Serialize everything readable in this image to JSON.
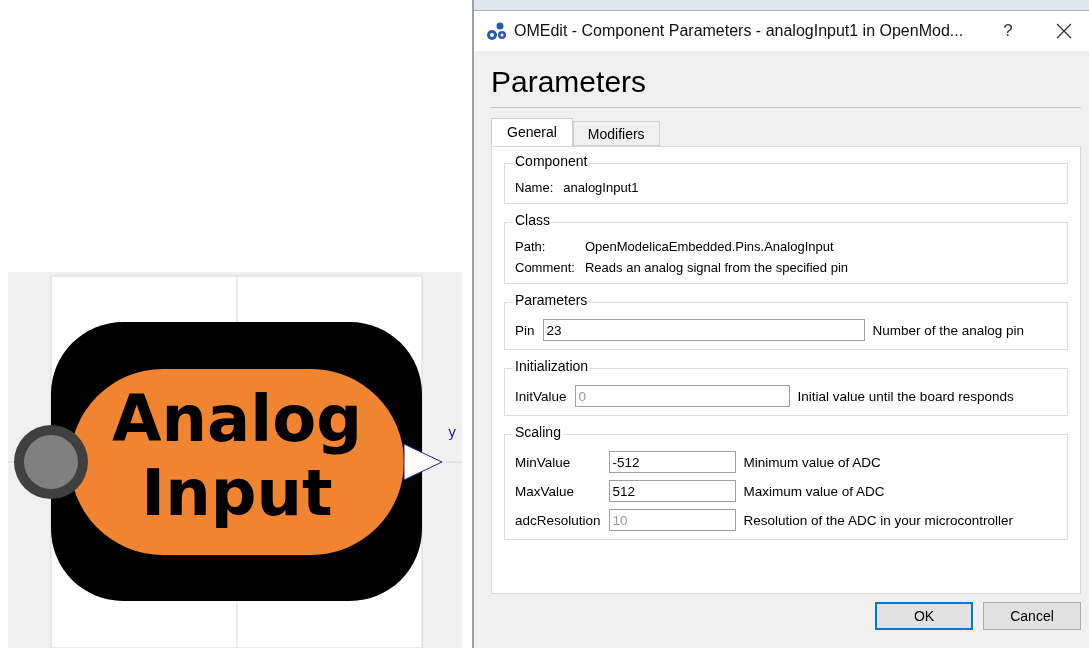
{
  "diagram": {
    "title_lines": [
      "Analog",
      "Input"
    ],
    "output_label": "y"
  },
  "window": {
    "title": "OMEdit - Component Parameters - analogInput1 in OpenMod...",
    "help": "?"
  },
  "heading": "Parameters",
  "tabs": [
    {
      "label": "General",
      "selected": true
    },
    {
      "label": "Modifiers",
      "selected": false
    }
  ],
  "groups": [
    {
      "kind": "info",
      "title": "Component",
      "rows": [
        {
          "label": "Name:",
          "value": "analogInput1"
        }
      ]
    },
    {
      "kind": "info",
      "title": "Class",
      "rows": [
        {
          "label": "Path:",
          "value": "OpenModelicaEmbedded.Pins.AnalogInput"
        },
        {
          "label": "Comment:",
          "value": "Reads an analog signal from the specified pin"
        }
      ]
    },
    {
      "kind": "params",
      "title": "Parameters",
      "rows": [
        {
          "label": "Pin",
          "value": "23",
          "comment": "Number of the analog pin"
        }
      ]
    },
    {
      "kind": "params",
      "title": "Initialization",
      "rows": [
        {
          "label": "InitValue",
          "placeholder": "0",
          "comment": "Initial value until the board responds"
        }
      ]
    },
    {
      "kind": "params",
      "title": "Scaling",
      "rows": [
        {
          "label": "MinValue",
          "value": "-512",
          "comment": "Minimum value of ADC"
        },
        {
          "label": "MaxValue",
          "value": "512",
          "comment": "Maximum value of ADC"
        },
        {
          "label": "adcResolution",
          "placeholder": "10",
          "comment": "Resolution of the ADC in your microcontroller"
        }
      ]
    }
  ],
  "buttons": [
    {
      "label": "OK",
      "default": true
    },
    {
      "label": "Cancel",
      "default": false
    }
  ]
}
